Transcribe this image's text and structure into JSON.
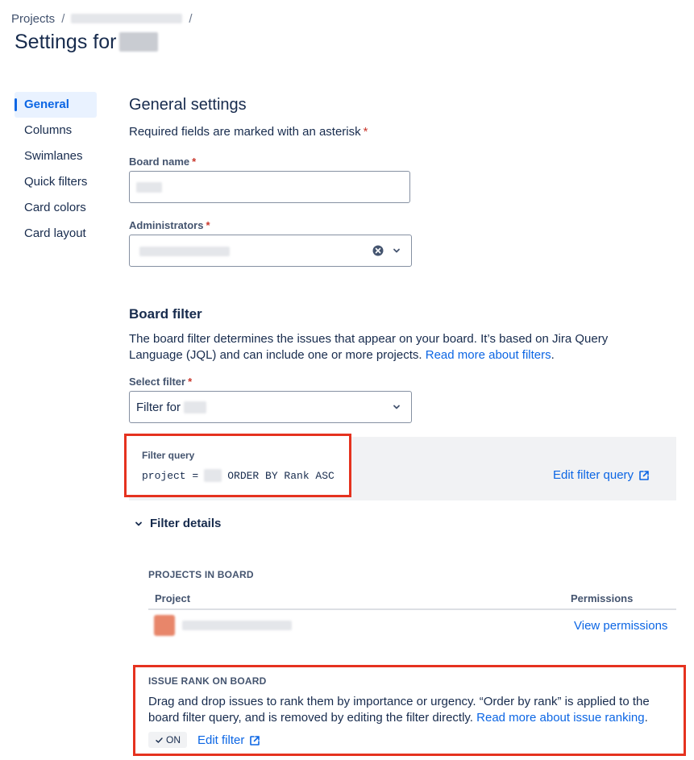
{
  "breadcrumb": {
    "projects_label": "Projects",
    "separator": "/"
  },
  "page": {
    "title_prefix": "Settings for"
  },
  "sidebar": {
    "items": [
      {
        "label": "General",
        "active": true
      },
      {
        "label": "Columns",
        "active": false
      },
      {
        "label": "Swimlanes",
        "active": false
      },
      {
        "label": "Quick filters",
        "active": false
      },
      {
        "label": "Card colors",
        "active": false
      },
      {
        "label": "Card layout",
        "active": false
      }
    ]
  },
  "general": {
    "heading": "General settings",
    "required_note": "Required fields are marked with an asterisk",
    "asterisk": "*",
    "board_name_label": "Board name",
    "administrators_label": "Administrators"
  },
  "board_filter": {
    "heading": "Board filter",
    "description": "The board filter determines the issues that appear on your board. It’s based on Jira Query Language (JQL) and can include one or more projects.",
    "read_more_link": "Read more about filters",
    "period": ".",
    "select_filter_label": "Select filter",
    "select_filter_value_prefix": "Filter for",
    "filter_query_label": "Filter query",
    "query_prefix": "project =",
    "query_suffix": "ORDER BY Rank ASC",
    "edit_filter_query_link": "Edit filter query"
  },
  "filter_details": {
    "toggle_label": "Filter details",
    "projects_heading": "PROJECTS IN BOARD",
    "columns": {
      "project": "Project",
      "permissions": "Permissions"
    },
    "view_permissions_link": "View permissions"
  },
  "issue_rank": {
    "heading": "ISSUE RANK ON BOARD",
    "description": "Drag and drop issues to rank them by importance or urgency. “Order by rank” is applied to the board filter query, and is removed by editing the filter directly.",
    "read_more_link": "Read more about issue ranking",
    "period": ".",
    "status_label": "ON",
    "edit_filter_link": "Edit filter"
  },
  "colors": {
    "accent": "#0c66e4",
    "required": "#c9372c",
    "highlight_box": "#e5321f",
    "panel_bg": "#f1f2f4"
  }
}
